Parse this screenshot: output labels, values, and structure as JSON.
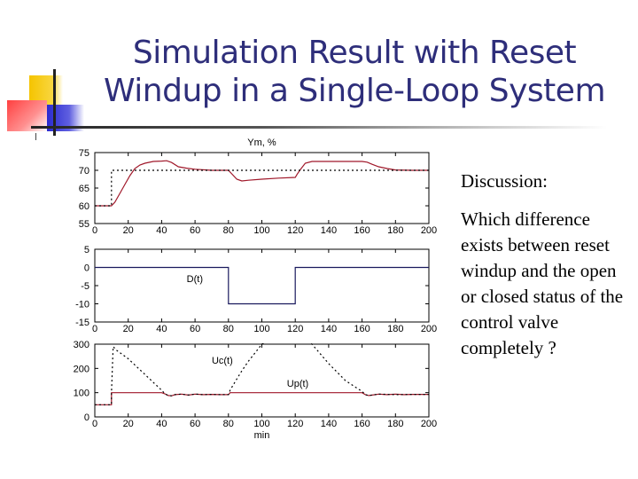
{
  "slide": {
    "title_line1": "Simulation Result with Reset",
    "title_line2": "Windup in a Single-Loop System",
    "discussion_heading": "Discussion:",
    "discussion_body": "Which difference exists between reset windup and the open or closed status of the control valve completely ?",
    "colors": {
      "title": "#2e2e7a",
      "series_red": "#a0182a",
      "series_blue": "#1a1a5e",
      "dashed": "#000000"
    }
  },
  "chart_data": [
    {
      "type": "line",
      "title": "Ym, %",
      "xlabel": "",
      "ylabel": "",
      "xlim": [
        0,
        200
      ],
      "ylim": [
        55,
        75
      ],
      "xticks": [
        0,
        20,
        40,
        60,
        80,
        100,
        120,
        140,
        160,
        180,
        200
      ],
      "xtick_labels": [
        "0",
        "20",
        "40",
        "60",
        "80",
        "100",
        "120",
        "140",
        "160",
        "180",
        "200"
      ],
      "yticks": [
        55,
        60,
        65,
        70,
        75
      ],
      "ytick_labels": [
        "55",
        "60",
        "65",
        "70",
        "75"
      ],
      "series": [
        {
          "name": "Ym",
          "style": "solid-red",
          "x": [
            0,
            10,
            12,
            15,
            18,
            21,
            24,
            27,
            30,
            35,
            40,
            43,
            46,
            50,
            55,
            60,
            70,
            80,
            82,
            85,
            88,
            92,
            100,
            110,
            120,
            121,
            123,
            126,
            130,
            140,
            150,
            160,
            163,
            166,
            170,
            175,
            180,
            190,
            200
          ],
          "y": [
            60,
            60,
            61,
            63.5,
            66,
            68.5,
            70.5,
            71.5,
            72,
            72.5,
            72.6,
            72.7,
            72.2,
            71,
            70.6,
            70.3,
            70,
            70,
            69,
            67.5,
            67,
            67.2,
            67.5,
            67.8,
            68,
            68.8,
            70.2,
            72,
            72.5,
            72.5,
            72.5,
            72.5,
            72.3,
            71.7,
            71,
            70.5,
            70.1,
            70,
            70
          ]
        },
        {
          "name": "Setpoint",
          "style": "dashed-black",
          "x": [
            0,
            10,
            10,
            200
          ],
          "y": [
            60,
            60,
            70,
            70
          ]
        }
      ]
    },
    {
      "type": "line",
      "title": "",
      "xlim": [
        0,
        200
      ],
      "ylim": [
        -15,
        5
      ],
      "xticks": [
        0,
        20,
        40,
        60,
        80,
        100,
        120,
        140,
        160,
        180,
        200
      ],
      "xtick_labels": [
        "0",
        "20",
        "40",
        "60",
        "80",
        "100",
        "120",
        "140",
        "160",
        "180",
        "200"
      ],
      "yticks": [
        -15,
        -10,
        -5,
        0,
        5
      ],
      "ytick_labels": [
        "-15",
        "-10",
        "-5",
        "0",
        "5"
      ],
      "annotations": [
        {
          "text": "D(t)",
          "x": 55,
          "y": -4
        }
      ],
      "series": [
        {
          "name": "D(t)",
          "style": "solid-blue",
          "x": [
            0,
            80,
            80,
            120,
            120,
            200
          ],
          "y": [
            0,
            0,
            -10,
            -10,
            0,
            0
          ]
        }
      ]
    },
    {
      "type": "line",
      "title": "",
      "xlabel": "min",
      "xlim": [
        0,
        200
      ],
      "ylim": [
        0,
        300
      ],
      "xticks": [
        0,
        20,
        40,
        60,
        80,
        100,
        120,
        140,
        160,
        180,
        200
      ],
      "xtick_labels": [
        "0",
        "20",
        "40",
        "60",
        "80",
        "100",
        "120",
        "140",
        "160",
        "180",
        "200"
      ],
      "yticks": [
        0,
        100,
        200,
        300
      ],
      "ytick_labels": [
        "0",
        "100",
        "200",
        "300"
      ],
      "annotations": [
        {
          "text": "Uc(t)",
          "x": 70,
          "y": 220
        },
        {
          "text": "Up(t)",
          "x": 115,
          "y": 125
        }
      ],
      "series": [
        {
          "name": "Up(t)",
          "style": "solid-red",
          "x": [
            0,
            10,
            10,
            40,
            42,
            44,
            46,
            48,
            52,
            56,
            60,
            65,
            70,
            75,
            80,
            81,
            100,
            120,
            140,
            160,
            162,
            164,
            166,
            170,
            175,
            180,
            185,
            190,
            200
          ],
          "y": [
            50,
            50,
            100,
            100,
            95,
            88,
            87,
            92,
            94,
            90,
            94,
            92,
            93,
            92,
            92,
            100,
            100,
            100,
            100,
            100,
            92,
            88,
            90,
            94,
            92,
            94,
            92,
            93,
            93
          ]
        },
        {
          "name": "Uc(t)",
          "style": "dashed-black",
          "x": [
            0,
            10,
            10,
            11,
            13,
            20,
            30,
            40,
            42,
            44,
            46,
            48,
            52,
            56,
            60,
            65,
            70,
            75,
            80,
            81,
            84,
            88,
            92,
            96,
            100,
            104,
            106,
            120,
            126,
            130,
            140,
            150,
            160,
            162,
            164,
            166,
            170,
            180,
            190,
            200
          ],
          "y": [
            50,
            50,
            100,
            290,
            275,
            240,
            175,
            110,
            95,
            88,
            87,
            92,
            94,
            90,
            94,
            92,
            93,
            92,
            92,
            110,
            145,
            190,
            230,
            265,
            300,
            320,
            330,
            330,
            320,
            300,
            220,
            150,
            105,
            92,
            88,
            90,
            94,
            92,
            93,
            93
          ]
        }
      ]
    }
  ]
}
